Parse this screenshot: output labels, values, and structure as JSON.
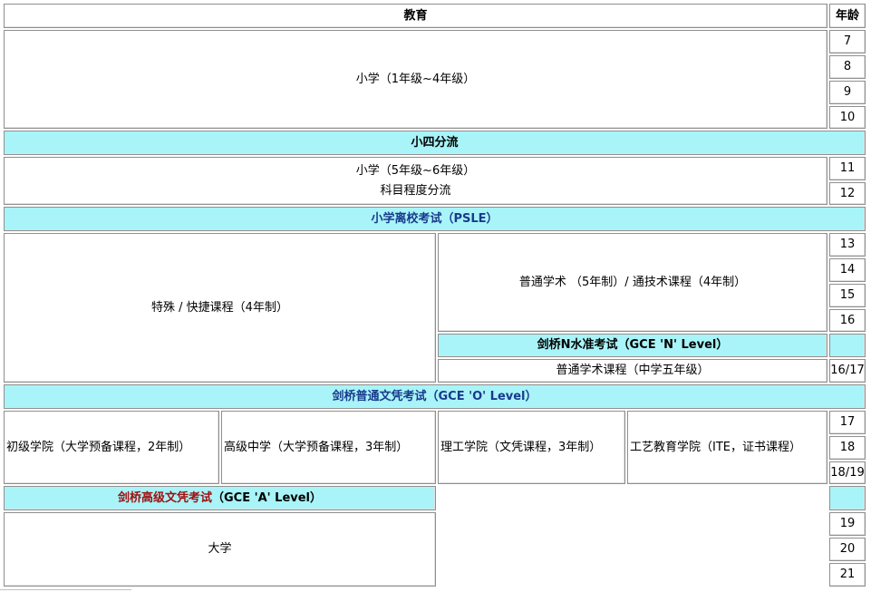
{
  "header": {
    "education": "教育",
    "age": "年龄"
  },
  "primary_1_4": {
    "label": "小学（1年级~4年级）",
    "ages": [
      "7",
      "8",
      "9",
      "10"
    ]
  },
  "streaming_p4": "小四分流",
  "primary_5_6": {
    "line1": "小学（5年级~6年级）",
    "line2": "科目程度分流",
    "ages": [
      "11",
      "12"
    ]
  },
  "psle": {
    "cn": "小学离校考试",
    "en": "（PSLE）"
  },
  "secondary": {
    "special_express": "特殊 / 快捷课程（4年制）",
    "normal": "普通学术 （5年制）/ 通技术课程（4年制）",
    "ages": [
      "13",
      "14",
      "15",
      "16"
    ],
    "n_level": {
      "cn": "剑桥N水准考试",
      "en": "（GCE 'N' Level）"
    },
    "normal_5th": "普通学术课程（中学五年级）",
    "age_16_17": "16/17"
  },
  "o_level": {
    "cn": "剑桥普通文凭考试",
    "en": "（GCE 'O' Level）"
  },
  "post_secondary": {
    "items": [
      "初级学院（大学预备课程，2年制）",
      "高级中学（大学预备课程，3年制）",
      "理工学院（文凭课程，3年制）",
      "工艺教育学院（ITE，证书课程）"
    ],
    "ages": [
      "17",
      "18",
      "18/19"
    ]
  },
  "a_level": {
    "cn": "剑桥高级文凭考试",
    "en": "（GCE 'A' Level）"
  },
  "university": {
    "label": "大学",
    "ages": [
      "19",
      "20",
      "21"
    ]
  },
  "colors": {
    "bar": "#a8f4f8",
    "navy_text": "#1a3a8c",
    "red_text": "#a01010"
  }
}
